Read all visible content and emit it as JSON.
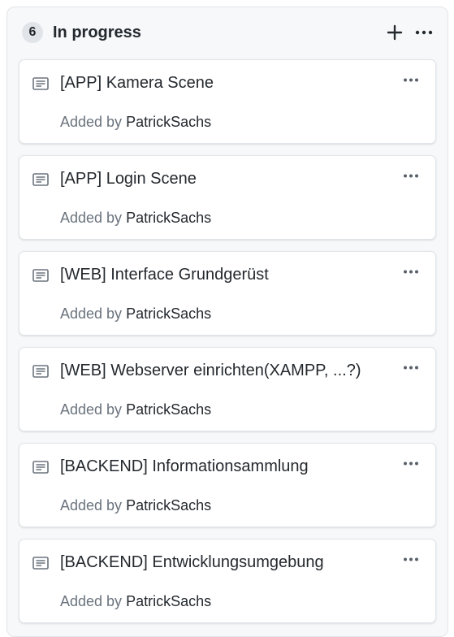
{
  "column": {
    "count": "6",
    "title": "In progress"
  },
  "icons": {
    "add": "plus-icon",
    "column_menu": "kebab-horizontal-icon",
    "card_type": "note-icon",
    "card_menu": "kebab-horizontal-icon"
  },
  "cards": [
    {
      "title": "[APP] Kamera Scene",
      "added_by_label": "Added by",
      "author": "PatrickSachs"
    },
    {
      "title": "[APP] Login Scene",
      "added_by_label": "Added by",
      "author": "PatrickSachs"
    },
    {
      "title": "[WEB] Interface Grundgerüst",
      "added_by_label": "Added by",
      "author": "PatrickSachs"
    },
    {
      "title": "[WEB] Webserver einrichten(XAMPP, ...?)",
      "added_by_label": "Added by",
      "author": "PatrickSachs"
    },
    {
      "title": "[BACKEND] Informationsammlung",
      "added_by_label": "Added by",
      "author": "PatrickSachs"
    },
    {
      "title": "[BACKEND] Entwicklungsumgebung",
      "added_by_label": "Added by",
      "author": "PatrickSachs"
    }
  ],
  "colors": {
    "column_bg": "#f6f8fa",
    "card_bg": "#ffffff",
    "border": "#e1e4e8",
    "text": "#24292e",
    "muted": "#6a737d"
  }
}
